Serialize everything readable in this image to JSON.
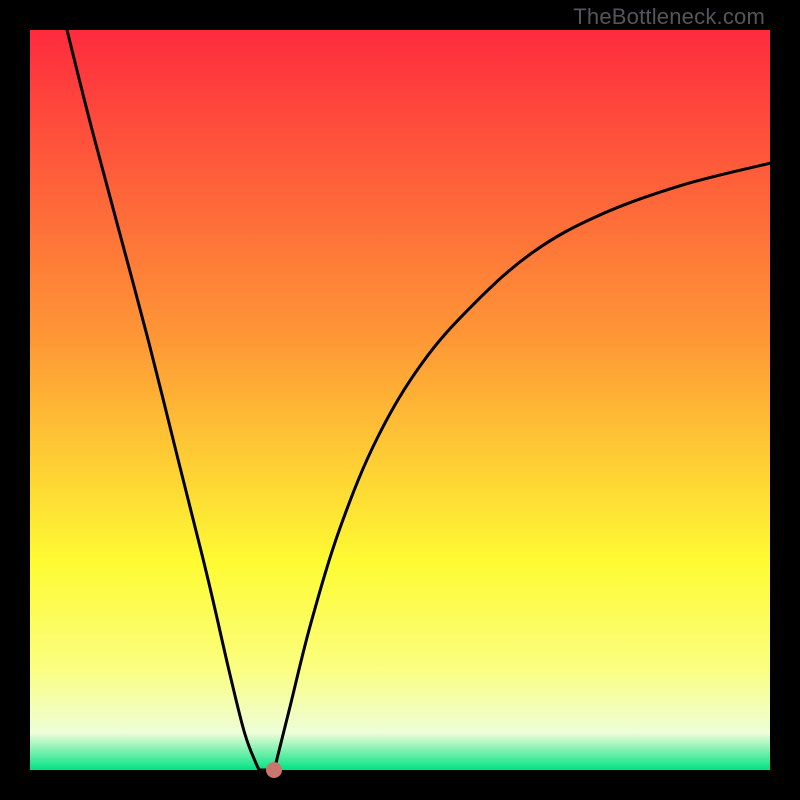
{
  "watermark": "TheBottleneck.com",
  "colors": {
    "top": "#fe2b3e",
    "mid_upper": "#fe9836",
    "mid": "#fefb33",
    "mid_lower": "#fbfe7e",
    "near_bottom": "#eefed8",
    "bottom": "#00e384",
    "curve": "#000000",
    "background": "#000000",
    "marker": "#c9766c"
  },
  "chart_data": {
    "type": "line",
    "title": "",
    "xlabel": "",
    "ylabel": "",
    "xlim": [
      0,
      100
    ],
    "ylim": [
      0,
      100
    ],
    "grid": false,
    "legend": false,
    "annotations": [
      "TheBottleneck.com"
    ],
    "series": [
      {
        "name": "left-branch",
        "x": [
          5,
          8,
          12,
          16,
          20,
          24,
          27,
          29,
          30.5,
          31
        ],
        "y": [
          100,
          88,
          73,
          58,
          42,
          26,
          13,
          5,
          1,
          0
        ]
      },
      {
        "name": "valley-floor",
        "x": [
          31,
          33
        ],
        "y": [
          0,
          0
        ]
      },
      {
        "name": "right-branch",
        "x": [
          33,
          35,
          38,
          42,
          47,
          53,
          60,
          68,
          77,
          88,
          100
        ],
        "y": [
          0,
          8,
          20,
          33,
          45,
          55,
          63,
          70,
          75,
          79,
          82
        ]
      }
    ],
    "marker": {
      "x": 33,
      "y": 0
    }
  }
}
